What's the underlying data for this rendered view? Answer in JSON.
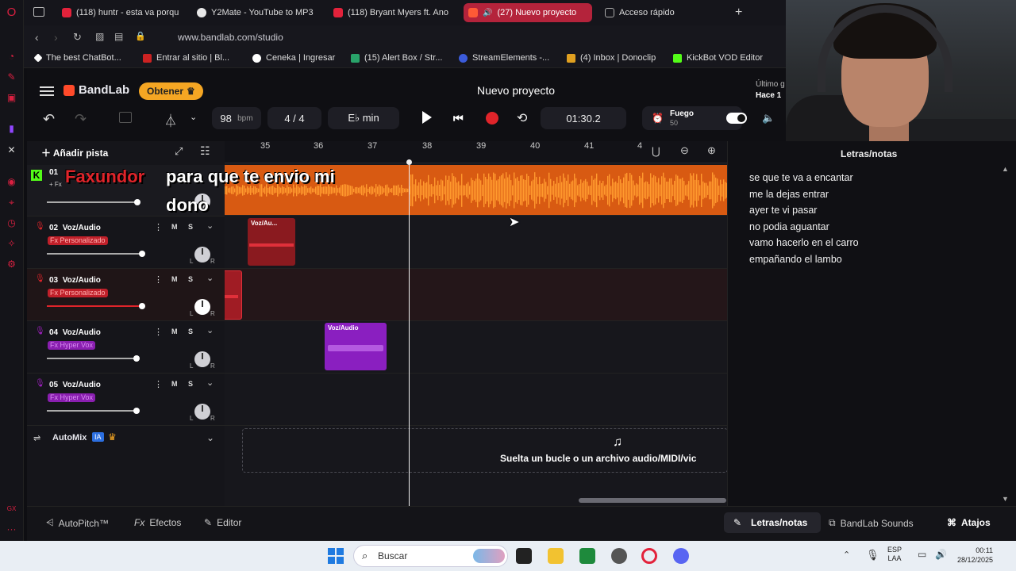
{
  "browser": {
    "tabs": [
      {
        "label": "(118) huntr - esta va porqu",
        "color": "#e3223b"
      },
      {
        "label": "Y2Mate - YouTube to MP3",
        "color": "#e8e8e8"
      },
      {
        "label": "(118) Bryant Myers ft. Ano",
        "color": "#e3223b"
      },
      {
        "label": "(27) Nuevo proyecto",
        "color": "#ff5a36"
      },
      {
        "label": "Acceso rápido",
        "color": "#aaaaaa"
      }
    ],
    "url": "www.bandlab.com/studio",
    "bookmarks": [
      {
        "label": "The best ChatBot...",
        "color": "#ffffff"
      },
      {
        "label": "Entrar al sitio | Bl...",
        "color": "#cc2222"
      },
      {
        "label": "Ceneka | Ingresar",
        "color": "#ffffff"
      },
      {
        "label": "(15) Alert Box / Str...",
        "color": "#29a36a"
      },
      {
        "label": "StreamElements -...",
        "color": "#3b5bdb"
      },
      {
        "label": "(4) Inbox | Donoclip",
        "color": "#e0a020"
      },
      {
        "label": "KickBot VOD Editor",
        "color": "#53fc18"
      }
    ]
  },
  "header": {
    "brand": "BandLab",
    "get_button": "Obtener",
    "project_title": "Nuevo proyecto",
    "last_save_1": "Último g",
    "last_save_2": "Hace 1",
    "bpm_value": "98",
    "bpm_unit": "bpm",
    "time_sig": "4 / 4",
    "key": "E♭ min",
    "time": "01:30.2",
    "preset_name": "Fuego",
    "preset_sub": "50",
    "accent": "#f5a623"
  },
  "toolbar": {
    "add_track": "Añadir pista",
    "ruler": [
      "35",
      "36",
      "37",
      "38",
      "39",
      "40",
      "41",
      "4"
    ]
  },
  "tracks": [
    {
      "num": "01",
      "name": "",
      "fx": "+ Fx"
    },
    {
      "num": "02",
      "name": "Voz/Audio",
      "fx": "Fx Personalizado",
      "clip": "Voz/Au..."
    },
    {
      "num": "03",
      "name": "Voz/Audio",
      "fx": "Fx Personalizado"
    },
    {
      "num": "04",
      "name": "Voz/Audio",
      "fx": "Fx Hyper Vox",
      "clip": "Voz/Audio"
    },
    {
      "num": "05",
      "name": "Voz/Audio",
      "fx": "Fx Hyper Vox"
    }
  ],
  "mute": "M",
  "solo": "S",
  "left": "L",
  "right": "R",
  "automix": {
    "label": "AutoMix",
    "badge": "IA"
  },
  "drop_hint": "Suelta un bucle o un archivo audio/MIDI/vic",
  "captions": {
    "name": "Faxundor",
    "line1": "para que te envio mi",
    "line2": "dono"
  },
  "lyrics": {
    "title": "Letras/notas",
    "lines": [
      "se que te va a encantar",
      "me la dejas  entrar",
      "ayer te vi pasar",
      "no podia aguantar",
      "vamo hacerlo en el carro",
      "empañando el lambo"
    ]
  },
  "bottom": {
    "autopitch": "AutoPitch™",
    "effects": "Efectos",
    "editor": "Editor",
    "lyrics_tab": "Letras/notas",
    "sounds": "BandLab Sounds",
    "shortcuts": "Atajos"
  },
  "taskbar": {
    "search": "Buscar",
    "lang1": "ESP",
    "lang2": "LAA",
    "clock": "00:11",
    "date": "28/12/2025"
  }
}
